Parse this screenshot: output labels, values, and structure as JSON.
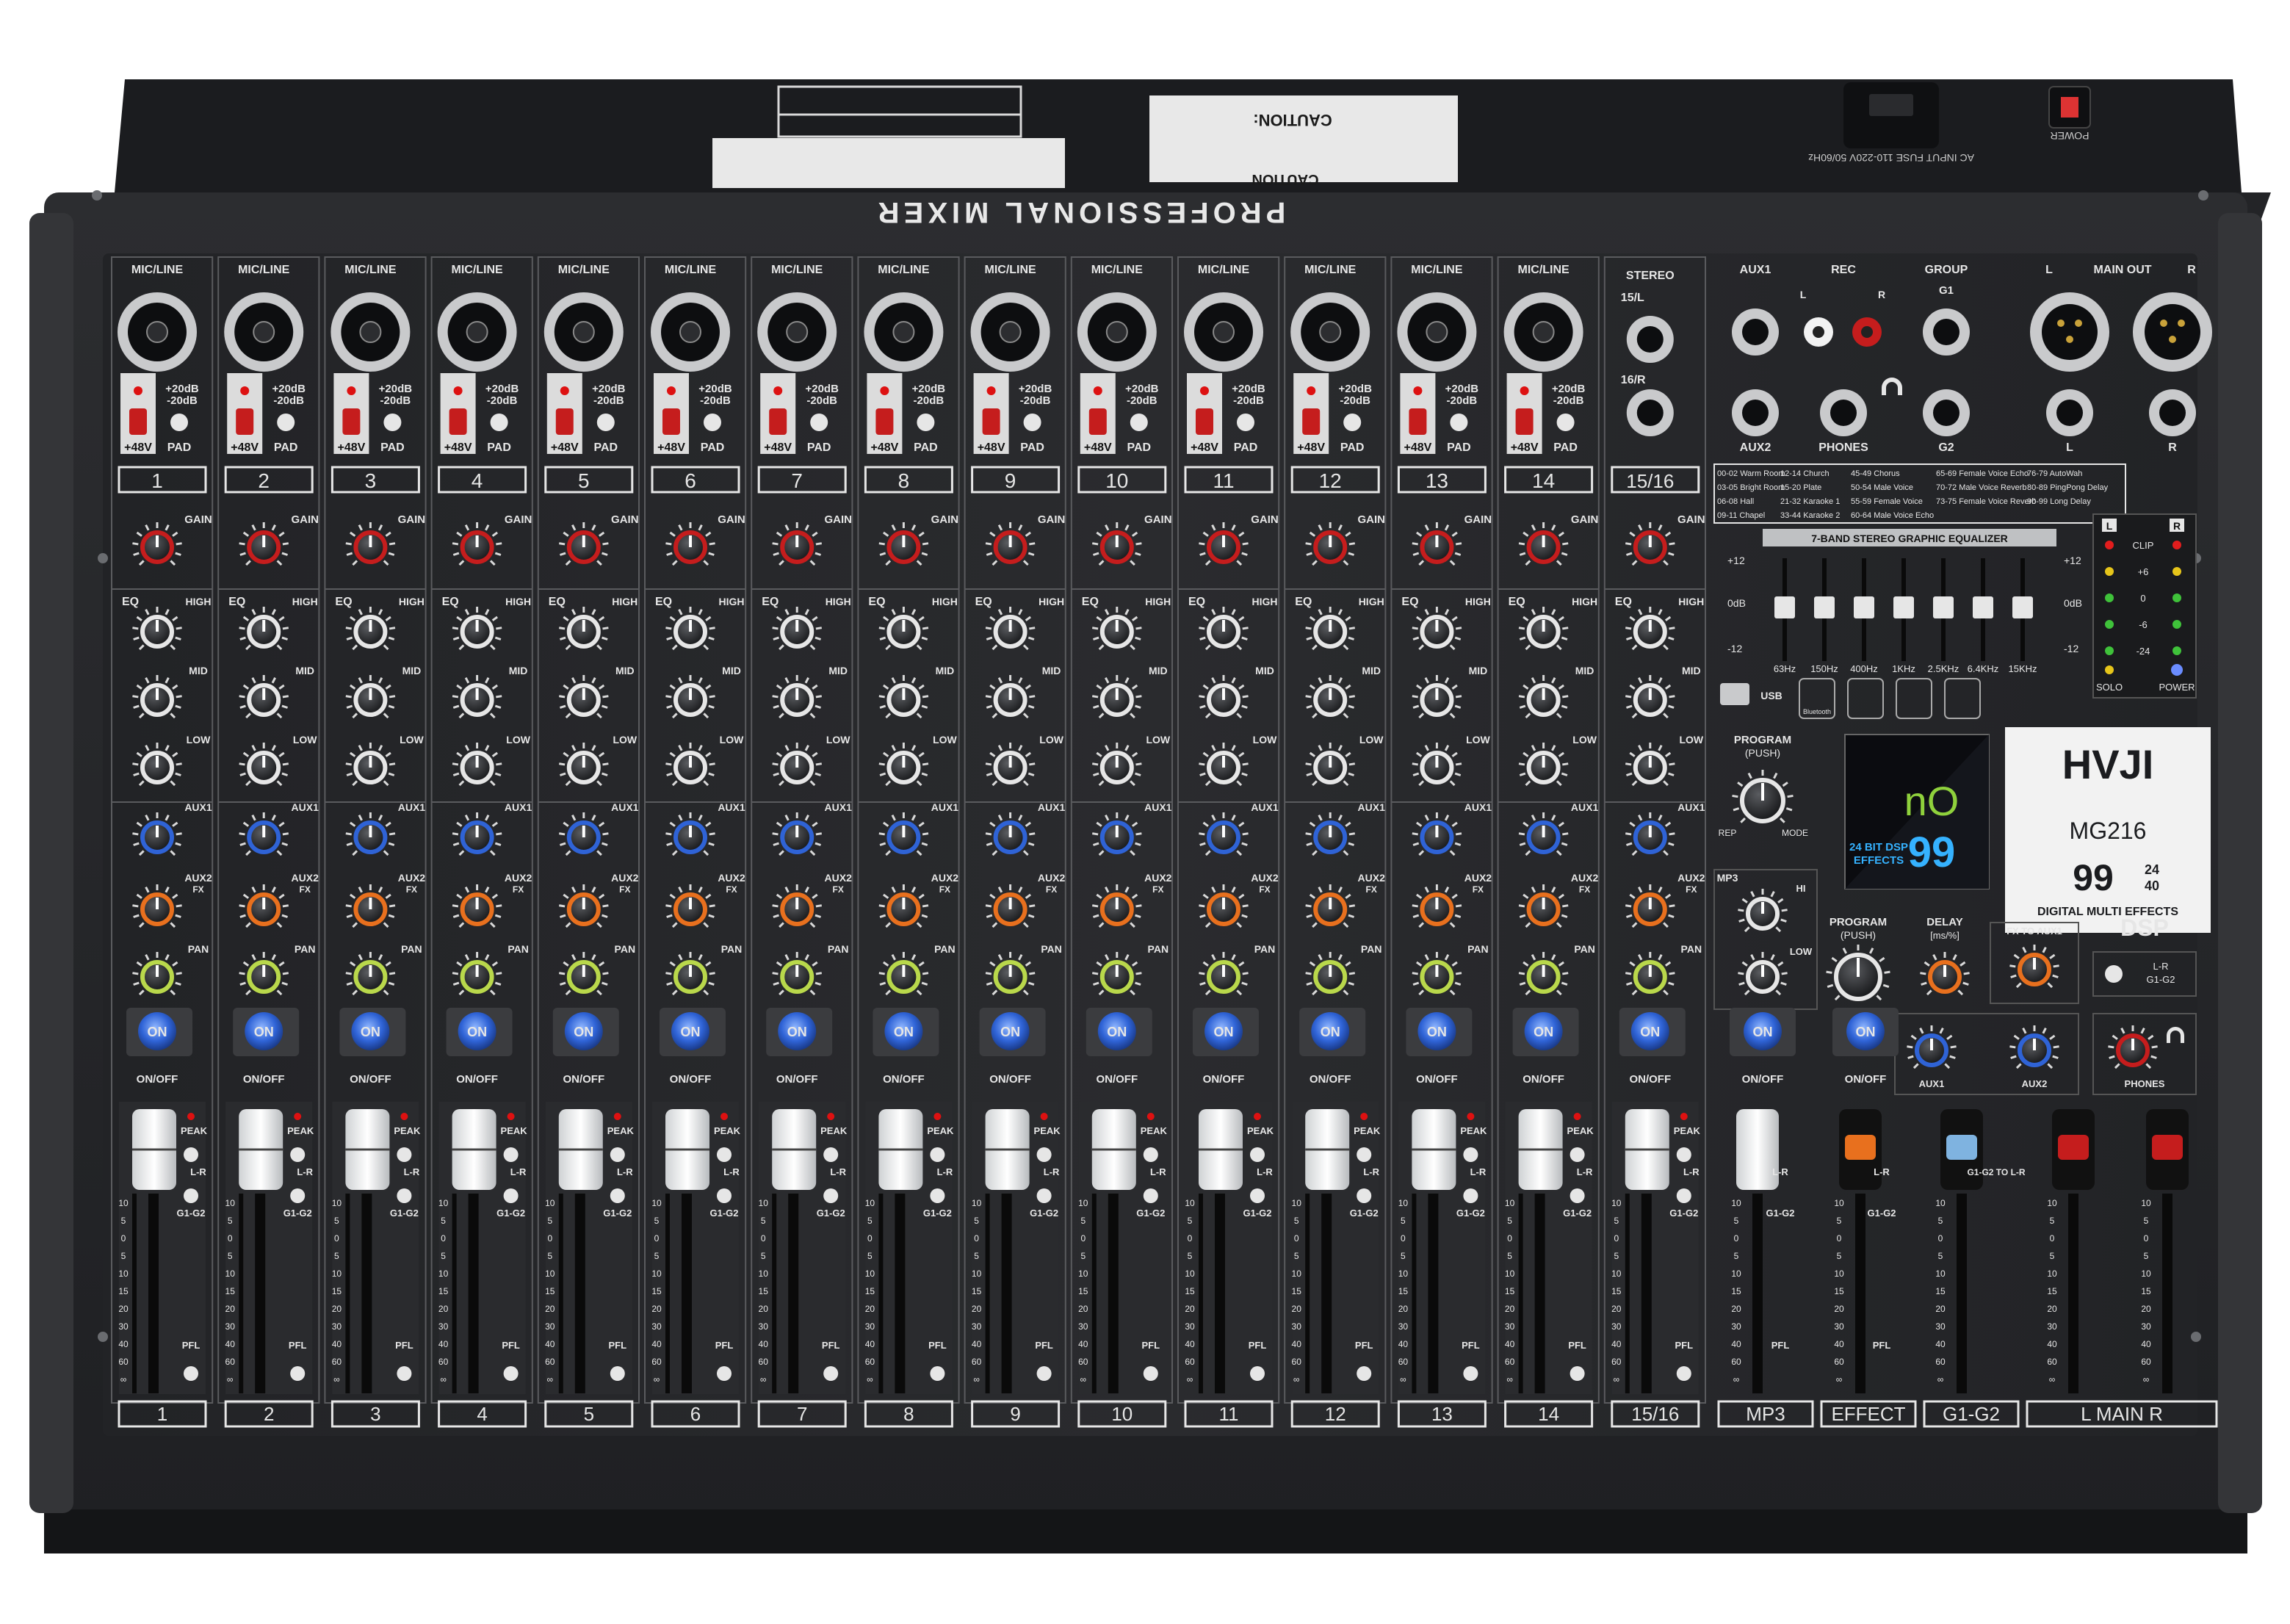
{
  "brand": {
    "logo": "HVJI",
    "model": "MG216"
  },
  "rear": {
    "title": "PROFESSIONAL MIXER",
    "caution1": "CAUTION",
    "caution2": "CAUTION:",
    "fuse": "AC INPUT FUSE 110-220V 50/60Hz",
    "power": "POWER"
  },
  "channels": {
    "mic_label": "MIC/LINE",
    "numbers": [
      "1",
      "2",
      "3",
      "4",
      "5",
      "6",
      "7",
      "8",
      "9",
      "10",
      "11",
      "12",
      "13",
      "14"
    ],
    "stereo_number": "15/16",
    "pad_high": "+20dB",
    "pad_low": "-20dB",
    "phantom": "+48V",
    "pad": "PAD",
    "gain": "GAIN",
    "eq": "EQ",
    "high": "HIGH",
    "mid": "MID",
    "low": "LOW",
    "aux1": "AUX1",
    "aux2": "AUX2",
    "fx": "FX",
    "pan": "PAN",
    "on": "ON",
    "onoff": "ON/OFF",
    "peak": "PEAK",
    "lr": "L-R",
    "g1g2": "G1-G2",
    "pfl": "PFL",
    "scale": [
      "10",
      "5",
      "0",
      "5",
      "10",
      "15",
      "20",
      "30",
      "40",
      "60",
      "∞"
    ]
  },
  "stereo": {
    "title": "STEREO",
    "l": "15/L",
    "r": "16/R"
  },
  "io": {
    "aux1": "AUX1",
    "aux2": "AUX2",
    "rec": "REC",
    "rec_l": "L",
    "rec_r": "R",
    "phones": "PHONES",
    "group": "GROUP",
    "g1": "G1",
    "g2": "G2",
    "main_out": "MAIN OUT",
    "main_l": "L",
    "main_r": "R"
  },
  "presets": [
    [
      "00-02 Warm Room",
      "12-14 Church",
      "45-49 Chorus",
      "65-69 Female Voice Echo",
      "76-79 AutoWah"
    ],
    [
      "03-05 Bright Room",
      "15-20 Plate",
      "50-54 Male Voice",
      "70-72 Male Voice Reverb",
      "80-89 PingPong Delay"
    ],
    [
      "06-08 Hall",
      "21-32 Karaoke 1",
      "55-59 Female Voice",
      "73-75 Female Voice Reverb",
      "90-99 Long Delay"
    ],
    [
      "09-11 Chapel",
      "33-44 Karaoke 2",
      "60-64 Male Voice Echo",
      "",
      ""
    ]
  ],
  "geq": {
    "title": "7-BAND STEREO GRAPHIC EQUALIZER",
    "plus": "+12",
    "zero": "0dB",
    "minus": "-12",
    "bands": [
      "63Hz",
      "150Hz",
      "400Hz",
      "1KHz",
      "2.5KHz",
      "6.4KHz",
      "15KHz"
    ]
  },
  "meter": {
    "l": "L",
    "r": "R",
    "levels": [
      "CLIP",
      "+6",
      "0",
      "-6",
      "-24"
    ],
    "solo": "SOLO",
    "power": "POWER"
  },
  "media": {
    "usb": "USB",
    "bluetooth": "Bluetooth",
    "program": "PROGRAM",
    "push": "(PUSH)",
    "rep": "REP",
    "mode": "MODE"
  },
  "display": {
    "top": "nO",
    "bottom": "99",
    "dsp1": "24 BIT DSP",
    "dsp2": "EFFECTS"
  },
  "fx": {
    "big": "99",
    "bits": "24",
    "bits2": "40",
    "title": "DIGITAL MULTI EFFECTS",
    "dsp": "DSP",
    "program": "PROGRAM",
    "push": "(PUSH)",
    "delay": "DELAY",
    "delay_unit": "[ms/%]",
    "fx_to_aux1": "FX TO AUX1",
    "lr": "L-R",
    "g1g2": "G1-G2",
    "aux1": "AUX1",
    "aux2": "AUX2",
    "phones": "PHONES",
    "mp3": "MP3",
    "hi": "HI",
    "low": "LOW"
  },
  "bottom_labels": [
    "1",
    "2",
    "3",
    "4",
    "5",
    "6",
    "7",
    "8",
    "9",
    "10",
    "11",
    "12",
    "13",
    "14",
    "15/16",
    "MP3",
    "EFFECT",
    "G1-G2",
    "L  MAIN  R"
  ],
  "g1g2_to_lr": "G1-G2 TO L-R"
}
